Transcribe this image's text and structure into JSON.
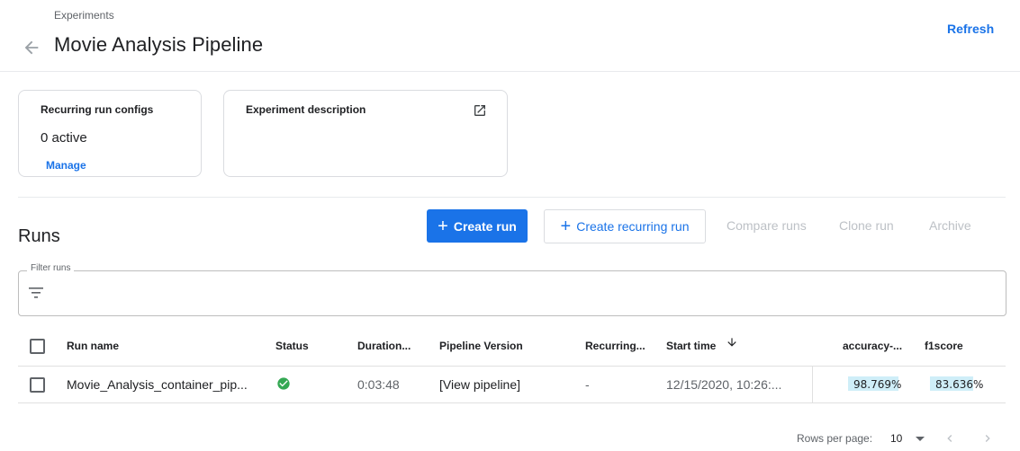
{
  "header": {
    "breadcrumb": "Experiments",
    "title": "Movie Analysis Pipeline",
    "refresh_label": "Refresh"
  },
  "cards": {
    "recurring": {
      "title": "Recurring run configs",
      "value": "0 active",
      "link": "Manage"
    },
    "description": {
      "title": "Experiment description"
    }
  },
  "runs": {
    "title": "Runs",
    "buttons": {
      "create_run": "Create run",
      "create_recurring_run": "Create recurring run",
      "compare_runs": "Compare runs",
      "clone_run": "Clone run",
      "archive": "Archive"
    },
    "filter_label": "Filter runs"
  },
  "table": {
    "columns": {
      "run_name": "Run name",
      "status": "Status",
      "duration": "Duration...",
      "pipeline_version": "Pipeline Version",
      "recurring": "Recurring...",
      "start_time": "Start time",
      "accuracy": "accuracy-...",
      "f1score": "f1score"
    },
    "rows": [
      {
        "run_name": "Movie_Analysis_container_pip...",
        "status": "succeeded",
        "duration": "0:03:48",
        "pipeline_version": "[View pipeline]",
        "recurring": "-",
        "start_time": "12/15/2020, 10:26:...",
        "accuracy": "98.769%",
        "accuracy_fraction": 0.98769,
        "f1score": "83.636%",
        "f1score_fraction": 0.83636
      }
    ]
  },
  "pagination": {
    "rows_per_page_label": "Rows per page:",
    "rows_per_page_value": "10"
  },
  "colors": {
    "accent": "#1a73e8",
    "success": "#34a853",
    "metric_bar": "#cfeef8"
  },
  "icons": [
    "back-arrow-icon",
    "open-in-new-icon",
    "plus-icon",
    "filter-icon",
    "check-circle-icon",
    "arrow-down-icon",
    "chevron-left-icon",
    "chevron-right-icon",
    "dropdown-caret-icon"
  ]
}
